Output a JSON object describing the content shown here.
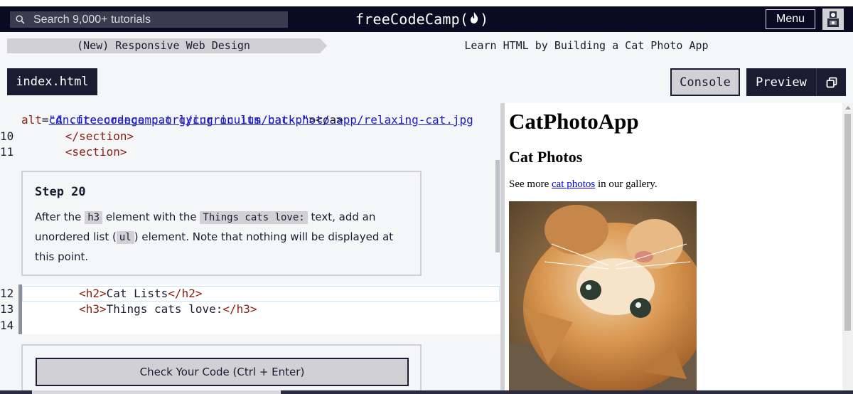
{
  "nav": {
    "search_placeholder": "Search 9,000+ tutorials",
    "brand_left": "freeCodeCamp(",
    "brand_right": ")",
    "menu_label": "Menu"
  },
  "breadcrumb": {
    "course": "(New) Responsive Web Design",
    "project": "Learn HTML by Building a Cat Photo App"
  },
  "toolbar": {
    "file_tab": "index.html",
    "console_label": "Console",
    "preview_label": "Preview"
  },
  "editor": {
    "line_url": "cdn.freecodecamp.org/curriculum/cat-photo-app/relaxing-cat.jpg",
    "line_alt_attr": "alt",
    "line_alt_eq": "=",
    "line_alt_value": "\"A cute orange cat lying on its back.\"",
    "line_alt_close": "></a>",
    "lines": [
      {
        "num": "10",
        "indent": "      ",
        "open": "</section>",
        "text": "",
        "close": ""
      },
      {
        "num": "11",
        "indent": "      ",
        "open": "<section>",
        "text": "",
        "close": ""
      },
      {
        "num": "12",
        "indent": "        ",
        "open": "<h2>",
        "text": "Cat Lists",
        "close": "</h2>"
      },
      {
        "num": "13",
        "indent": "        ",
        "open": "<h3>",
        "text": "Things cats love:",
        "close": "</h3>"
      },
      {
        "num": "14",
        "indent": "",
        "open": "",
        "text": "",
        "close": ""
      }
    ]
  },
  "step": {
    "title": "Step 20",
    "text_1": "After the ",
    "code_1": "h3",
    "text_2": " element with the ",
    "code_2": "Things cats love:",
    "text_3": " text, add an unordered list (",
    "code_3": "ul",
    "text_4": ") element. Note that nothing will be displayed at this point."
  },
  "actions": {
    "check_label": "Check Your Code (Ctrl + Enter)"
  },
  "preview": {
    "heading": "CatPhotoApp",
    "subheading": "Cat Photos",
    "text_before": "See more ",
    "link": "cat photos",
    "text_after": " in our gallery."
  },
  "colors": {
    "nav_bg": "#0a0a23",
    "panel_bg": "#f5f6f7",
    "dark": "#1b1b32",
    "gray": "#d0d0d5",
    "tag": "#8a1c10",
    "string": "#1b1bcc"
  }
}
